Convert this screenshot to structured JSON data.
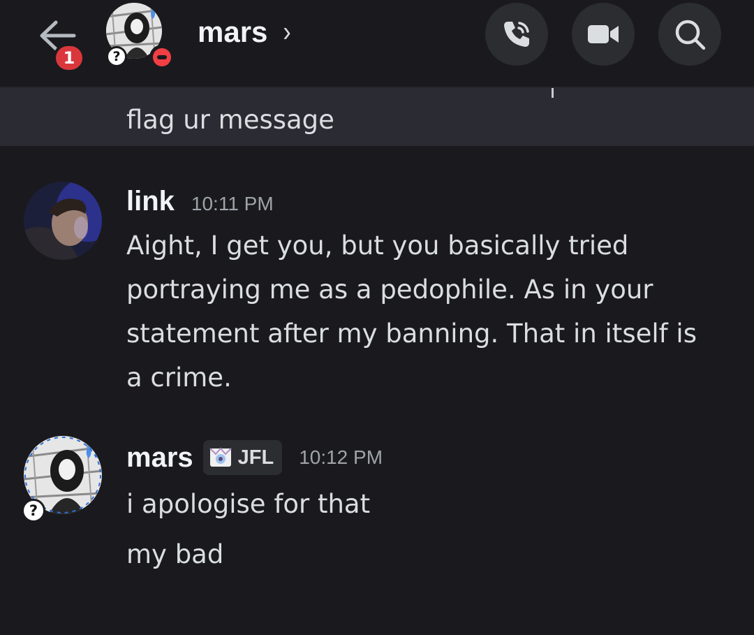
{
  "header": {
    "title": "mars",
    "chevron": "›",
    "unread_count": "1",
    "status": "do-not-disturb",
    "buttons": [
      "voice-call-icon",
      "video-call-icon",
      "search-icon"
    ]
  },
  "quoted": {
    "text": "flag ur message"
  },
  "messages": [
    {
      "author": "link",
      "time": "10:11 PM",
      "lines": [
        "Aight, I get you, but you basically tried",
        "portraying me as a pedophile. As in your",
        "statement after my banning. That in itself is",
        "a crime."
      ]
    },
    {
      "author": "mars",
      "tag": "JFL",
      "time": "10:12 PM",
      "lines": [
        "i apologise for that",
        "my bad"
      ]
    }
  ],
  "colors": {
    "background": "#1a1a1e",
    "quoted_background": "#2a2b33",
    "badge_red": "#da373c",
    "dnd_red": "#f23f43"
  }
}
